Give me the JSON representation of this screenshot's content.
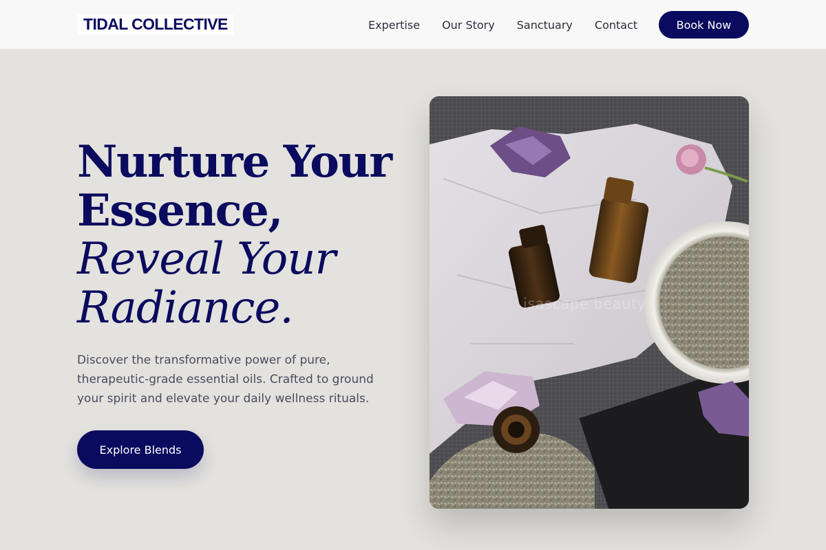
{
  "header": {
    "brand": "TIDAL COLLECTIVE",
    "nav": [
      "Expertise",
      "Our Story",
      "Sanctuary",
      "Contact"
    ],
    "cta_label": "Book Now"
  },
  "hero": {
    "title_line1": "Nurture Your",
    "title_line2": "Essence,",
    "title_line3": "Reveal Your",
    "title_line4": "Radiance.",
    "description": "Discover the transformative power of pure, therapeutic-grade essential oils. Crafted to ground your spirit and elevate your daily wellness rituals.",
    "button_label": "Explore Blends",
    "image_watermark": "isascape beauty"
  },
  "colors": {
    "navy": "#0a0a5e",
    "background": "#e3e2de",
    "header_bg": "#f8f8f8"
  }
}
